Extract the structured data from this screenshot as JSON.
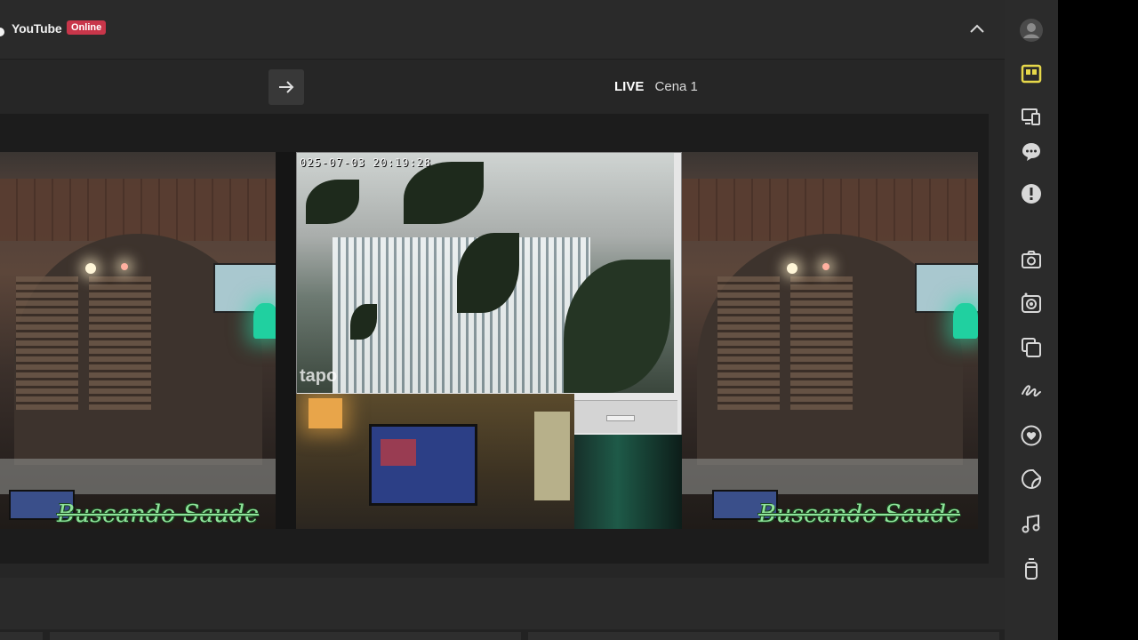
{
  "header": {
    "platform": "YouTube",
    "status_badge": "Online"
  },
  "scene_bar": {
    "live_label": "LIVE",
    "scene_name": "Cena 1"
  },
  "preview": {
    "timestamp": "025-07-03 20:19:28",
    "watermark": "tapo",
    "caption": "Buscando Saude"
  },
  "colors": {
    "accent_yellow": "#e6d84a",
    "badge_red": "#c8364a",
    "caption_green": "#8ee39a"
  },
  "dock_icons": [
    "avatar-icon",
    "layout-icon",
    "devices-icon",
    "chat-icon",
    "alert-icon",
    "camera-icon",
    "camera-flip-icon",
    "layers-icon",
    "draw-icon",
    "heart-icon",
    "sticker-icon",
    "music-icon",
    "remote-icon"
  ]
}
